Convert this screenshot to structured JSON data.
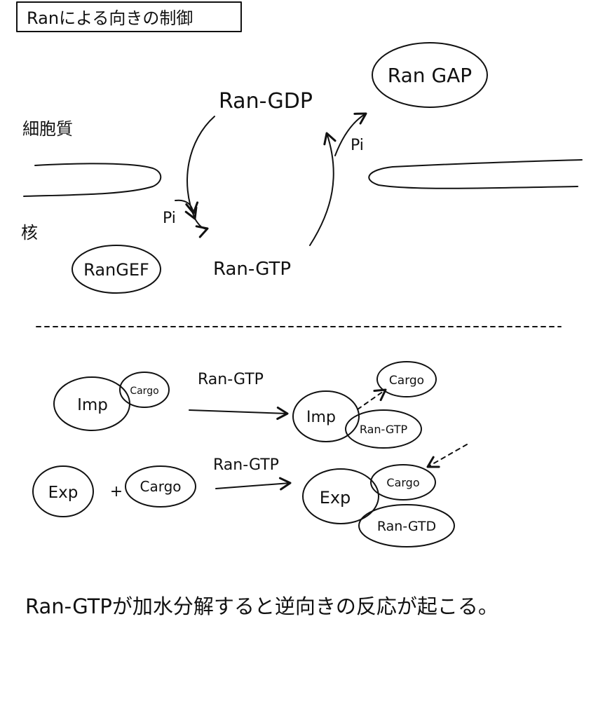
{
  "title": "Ranによる向きの制御",
  "cycle": {
    "cytoplasm_label": "細胞質",
    "nucleus_label": "核",
    "ran_gdp": "Ran-GDP",
    "ran_gtp": "Ran-GTP",
    "ran_gap": "Ran GAP",
    "ran_gef": "RanGEF",
    "pi_top": "Pi",
    "pi_left": "Pi"
  },
  "import_reaction": {
    "importin": "Imp",
    "cargo": "Cargo",
    "arrow_label": "Ran-GTP",
    "product_importin": "Imp",
    "product_ran_gtp": "Ran-GTP",
    "released_cargo": "Cargo"
  },
  "export_reaction": {
    "exportin": "Exp",
    "plus": "+",
    "cargo": "Cargo",
    "arrow_label": "Ran-GTP",
    "product_exportin": "Exp",
    "product_cargo": "Cargo",
    "product_ran_gtp": "Ran-GTD"
  },
  "note": "Ran-GTPが加水分解すると逆向きの反応が起こる。"
}
